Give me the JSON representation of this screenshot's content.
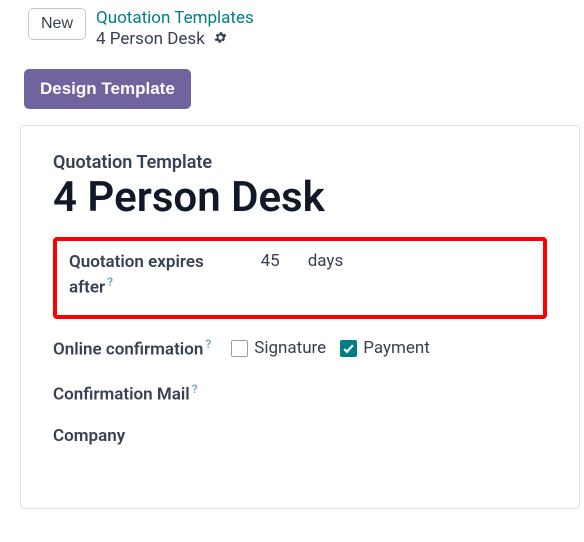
{
  "header": {
    "new_button": "New",
    "breadcrumb_parent": "Quotation Templates",
    "breadcrumb_current": "4 Person Desk"
  },
  "actions": {
    "design_template": "Design Template"
  },
  "form": {
    "section_label": "Quotation Template",
    "title": "4 Person Desk",
    "expires": {
      "label_line1": "Quotation expires",
      "label_line2": "after",
      "value": "45",
      "unit": "days"
    },
    "online_confirmation": {
      "label": "Online confirmation",
      "signature_label": "Signature",
      "signature_checked": false,
      "payment_label": "Payment",
      "payment_checked": true
    },
    "confirmation_mail_label": "Confirmation Mail",
    "company_label": "Company"
  },
  "help_glyph": "?"
}
